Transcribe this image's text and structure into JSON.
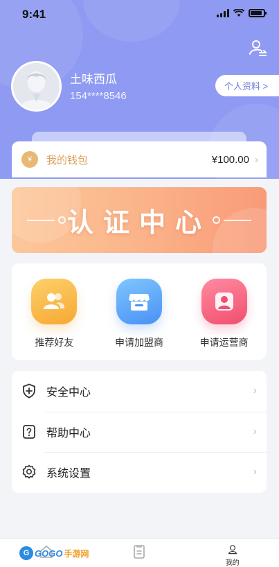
{
  "status_bar": {
    "time": "9:41"
  },
  "profile": {
    "name": "土味西瓜",
    "phone": "154****8546",
    "profile_button": "个人资料 >"
  },
  "wallet": {
    "label": "我的钱包",
    "amount": "¥100.00",
    "icon_glyph": "¥"
  },
  "banner": {
    "title": "认证中心"
  },
  "services": [
    {
      "label": "推荐好友",
      "icon": "friends-icon",
      "color": "#f7a833"
    },
    {
      "label": "申请加盟商",
      "icon": "store-icon",
      "color": "#4a91f5"
    },
    {
      "label": "申请运营商",
      "icon": "operator-icon",
      "color": "#f04f6e"
    }
  ],
  "menu": [
    {
      "label": "安全中心",
      "icon": "shield-plus-icon"
    },
    {
      "label": "帮助中心",
      "icon": "help-icon"
    },
    {
      "label": "系统设置",
      "icon": "gear-icon"
    }
  ],
  "tabbar": {
    "tabs": [
      {
        "label": "",
        "icon": "home-icon"
      },
      {
        "label": "",
        "icon": "orders-icon"
      },
      {
        "label": "我的",
        "icon": "user-icon",
        "active": true
      }
    ]
  },
  "watermark": {
    "logo": "G",
    "text": "GOGO",
    "text2": "手游网"
  },
  "colors": {
    "header": "#8f9bf2",
    "accent": "#6a7ce0",
    "wallet_gold": "#d9a35e"
  }
}
